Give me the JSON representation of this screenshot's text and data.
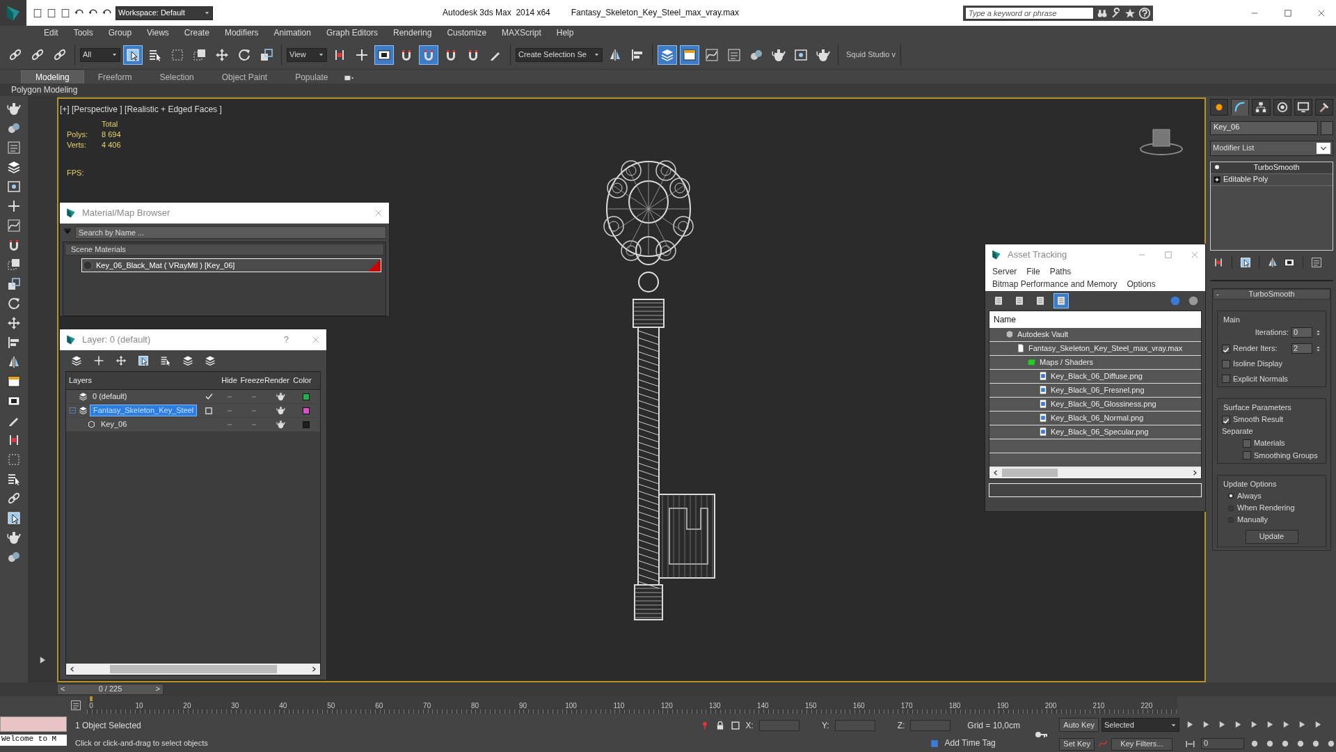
{
  "title_bar": {
    "workspace": "Workspace: Default",
    "title": "Autodesk 3ds Max  2014 x64",
    "file": "Fantasy_Skeleton_Key_Steel_max_vray.max",
    "search_placeholder": "Type a keyword or phrase"
  },
  "menu": [
    "Edit",
    "Tools",
    "Group",
    "Views",
    "Create",
    "Modifiers",
    "Animation",
    "Graph Editors",
    "Rendering",
    "Customize",
    "MAXScript",
    "Help"
  ],
  "toolbar": [
    {
      "kind": "link",
      "selected": false
    },
    {
      "kind": "unlink",
      "selected": false
    },
    {
      "kind": "bind",
      "selected": false
    },
    {
      "kind": "dropdown",
      "value": "All"
    },
    {
      "kind": "cursor",
      "selected": true
    },
    {
      "kind": "select_by_name",
      "selected": false
    },
    {
      "kind": "region",
      "selected": false
    },
    {
      "kind": "window",
      "selected": false
    },
    {
      "kind": "move",
      "selected": false
    },
    {
      "kind": "rotate",
      "selected": false
    },
    {
      "kind": "scale",
      "selected": false
    },
    {
      "kind": "dropdown",
      "value": "View"
    },
    {
      "kind": "pivot",
      "selected": false
    },
    {
      "kind": "manipulate",
      "selected": false
    },
    {
      "kind": "keyboard",
      "selected": true
    },
    {
      "kind": "snap",
      "selected": false
    },
    {
      "kind": "angle_snap",
      "selected": true
    },
    {
      "kind": "percent_snap",
      "selected": false
    },
    {
      "kind": "spinner_snap",
      "selected": false
    },
    {
      "kind": "edit_sets",
      "selected": false
    },
    {
      "kind": "dropdown",
      "value": "Create Selection Se"
    },
    {
      "kind": "mirror",
      "selected": false
    },
    {
      "kind": "align",
      "selected": false
    },
    {
      "kind": "layers",
      "selected": true
    },
    {
      "kind": "ribbon",
      "selected": true
    },
    {
      "kind": "curve",
      "selected": false
    },
    {
      "kind": "schematic",
      "selected": false
    },
    {
      "kind": "material",
      "selected": false
    },
    {
      "kind": "render_setup",
      "selected": false
    },
    {
      "kind": "frame",
      "selected": false
    },
    {
      "kind": "render",
      "selected": false
    },
    {
      "kind": "label",
      "value": "Squid Studio v"
    }
  ],
  "ribbon": {
    "tabs": [
      {
        "label": "Modeling",
        "selected": true
      },
      {
        "label": "Freeform",
        "selected": false
      },
      {
        "label": "Selection",
        "selected": false
      },
      {
        "label": "Object Paint",
        "selected": false
      },
      {
        "label": "Populate",
        "selected": false
      }
    ],
    "panel": "Polygon Modeling"
  },
  "viewport": {
    "label": "[+] [Perspective ] [Realistic + Edged Faces ]",
    "stats_header": "Total",
    "stats": [
      {
        "label": "Polys:",
        "value": "8 694"
      },
      {
        "label": "Verts:",
        "value": "4 406"
      }
    ],
    "fps_label": "FPS:"
  },
  "material_browser": {
    "title": "Material/Map Browser",
    "search_placeholder": "Search by Name ...",
    "group": "Scene Materials",
    "items": [
      {
        "label": "Key_06_Black_Mat  ( VRayMtl )  [Key_06]",
        "selected": true
      }
    ]
  },
  "layer_manager": {
    "title": "Layer: 0 (default)",
    "help": "?",
    "columns": [
      "Layers",
      "Hide",
      "Freeze",
      "Render",
      "Color"
    ],
    "layers": [
      {
        "name": "0 (default)",
        "kind": "layer",
        "current": true,
        "selected": false,
        "color": "#22b14c"
      },
      {
        "name": "Fantasy_Skeleton_Key_Steel",
        "kind": "layer",
        "current": false,
        "selected": true,
        "expanded": true,
        "color": "#d94fc9",
        "children": [
          {
            "name": "Key_06",
            "kind": "object",
            "selected": false,
            "color": "#1e1e1e"
          }
        ]
      }
    ]
  },
  "asset_tracking": {
    "title": "Asset Tracking",
    "menus": [
      [
        "Server",
        "File",
        "Paths"
      ],
      [
        "Bitmap Performance and Memory",
        "Options"
      ]
    ],
    "view_modes": [
      {
        "selected": false
      },
      {
        "selected": false
      },
      {
        "selected": false
      },
      {
        "selected": true
      }
    ],
    "column": "Name",
    "tree": [
      {
        "label": "Autodesk Vault",
        "kind": "vault",
        "children": [
          {
            "label": "Fantasy_Skeleton_Key_Steel_max_vray.max",
            "kind": "file",
            "children": [
              {
                "label": "Maps / Shaders",
                "kind": "folder",
                "children": [
                  {
                    "label": "Key_Black_06_Diffuse.png",
                    "kind": "image"
                  },
                  {
                    "label": "Key_Black_06_Fresnel.png",
                    "kind": "image"
                  },
                  {
                    "label": "Key_Black_06_Glossiness.png",
                    "kind": "image"
                  },
                  {
                    "label": "Key_Black_06_Normal.png",
                    "kind": "image"
                  },
                  {
                    "label": "Key_Black_06_Specular.png",
                    "kind": "image"
                  }
                ]
              }
            ]
          }
        ]
      }
    ]
  },
  "command_panel": {
    "tabs": [
      {
        "kind": "create",
        "selected": false
      },
      {
        "kind": "modify",
        "selected": true
      },
      {
        "kind": "hierarchy",
        "selected": false
      },
      {
        "kind": "motion",
        "selected": false
      },
      {
        "kind": "display",
        "selected": false
      },
      {
        "kind": "utilities",
        "selected": false
      }
    ],
    "object_name": "Key_06",
    "modifier_list": "Modifier List",
    "stack": [
      {
        "label": "TurboSmooth",
        "kind": "modifier",
        "selected": true
      },
      {
        "label": "Editable Poly",
        "kind": "base",
        "selected": false
      }
    ],
    "rollout": {
      "collapse": "-",
      "title": "TurboSmooth",
      "main_title": "Main",
      "iterations_label": "Iterations:",
      "iterations": "0",
      "render_iters": {
        "label": "Render Iters:",
        "checked": true,
        "value": "2"
      },
      "main_options": [
        {
          "label": "Isoline Display",
          "checked": false
        },
        {
          "label": "Explicit Normals",
          "checked": false
        }
      ],
      "surface_title": "Surface Parameters",
      "smooth_result": {
        "label": "Smooth Result",
        "checked": true
      },
      "separate_label": "Separate",
      "separate": [
        {
          "label": "Materials",
          "checked": false
        },
        {
          "label": "Smoothing Groups",
          "checked": false
        }
      ],
      "update_title": "Update Options",
      "update_options": [
        {
          "label": "Always",
          "selected": true
        },
        {
          "label": "When Rendering",
          "selected": false
        },
        {
          "label": "Manually",
          "selected": false
        }
      ],
      "update_button": "Update"
    }
  },
  "timeline": {
    "level": 0,
    "prev": "<",
    "frame": "0 / 225",
    "next": ">",
    "ticks": [
      "0",
      "10",
      "20",
      "30",
      "40",
      "50",
      "60",
      "70",
      "80",
      "90",
      "100",
      "110",
      "120",
      "130",
      "140",
      "150",
      "160",
      "170",
      "180",
      "190",
      "200",
      "210",
      "220"
    ]
  },
  "status_bar": {
    "listener": "Welcome to M",
    "selection": "1 Object Selected",
    "prompt": "Click or click-and-drag to select objects",
    "x_label": "X:",
    "y_label": "Y:",
    "z_label": "Z:",
    "grid": "Grid = 10,0cm",
    "add_time_tag": "Add Time Tag",
    "auto_key": "Auto Key",
    "set_key": "Set Key",
    "key_mode": "Selected",
    "key_filters": "Key Filters...",
    "current_frame": "0"
  }
}
